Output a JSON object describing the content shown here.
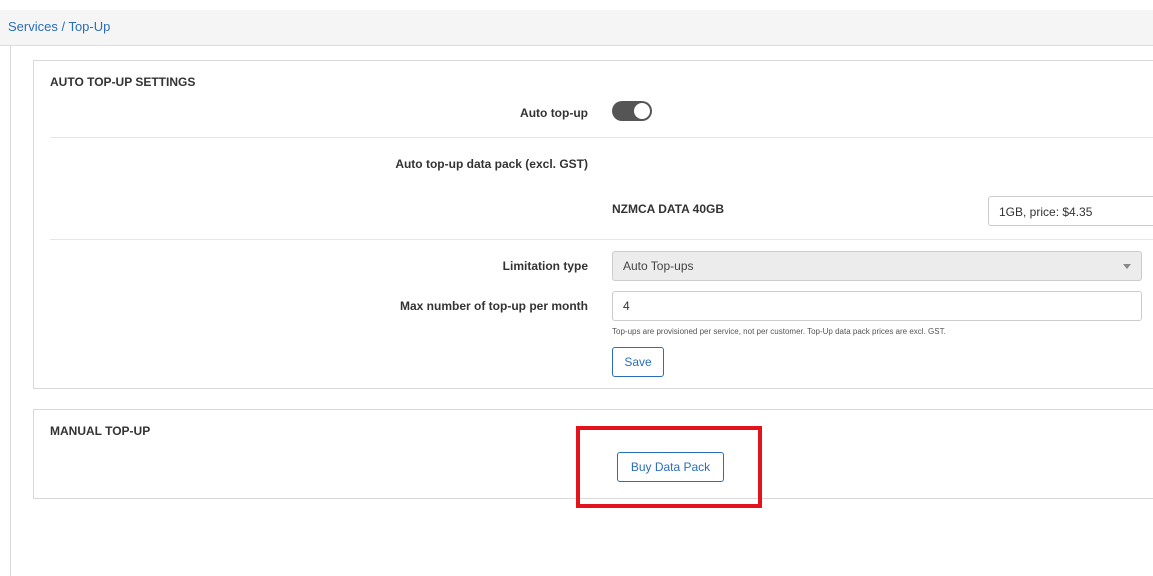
{
  "breadcrumb": "Services / Top-Up",
  "auto_topup": {
    "title": "AUTO TOP-UP SETTINGS",
    "toggle_label": "Auto top-up",
    "toggle_on": true,
    "pack_label": "Auto top-up data pack (excl. GST)",
    "pack_name": "NZMCA DATA 40GB",
    "pack_option": "1GB, price: $4.35",
    "limitation_label": "Limitation type",
    "limitation_value": "Auto Top-ups",
    "max_label": "Max number of top-up per month",
    "max_value": "4",
    "help_text": "Top-ups are provisioned per service, not per customer. Top-Up data pack prices are excl. GST.",
    "save_label": "Save"
  },
  "manual_topup": {
    "title": "MANUAL TOP-UP",
    "buy_label": "Buy Data Pack"
  },
  "colors": {
    "link": "#2a6ebb",
    "highlight": "#e3121b",
    "toggle": "#555555"
  }
}
